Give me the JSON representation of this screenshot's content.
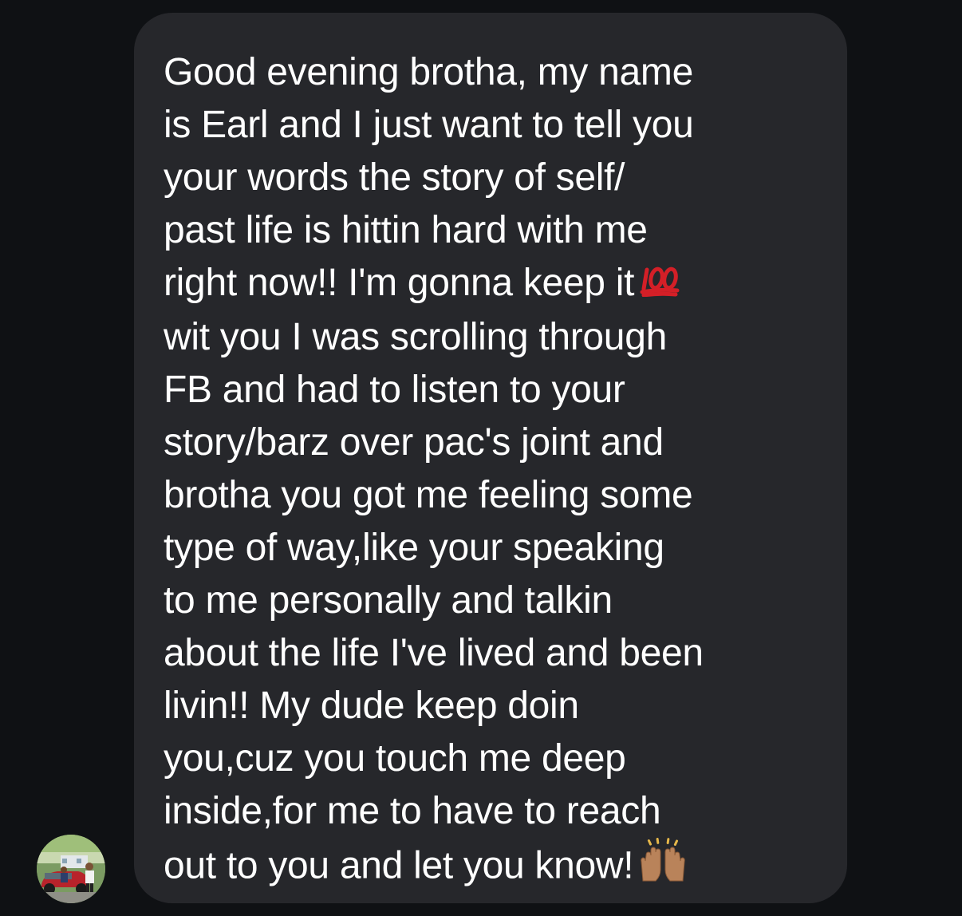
{
  "message": {
    "lines": [
      "Good evening brotha, my name",
      "is Earl and I just want to tell you",
      "your words the story of self/",
      "past life is hittin hard with me",
      "right now!! I'm gonna keep it",
      "wit you I was scrolling through",
      "FB and had to listen to your",
      "story/barz over pac's joint and",
      "brotha you got me feeling some",
      "type of way,like your speaking",
      "to me personally and talkin",
      "about the life I've lived and been",
      "livin!! My dude keep doin",
      "you,cuz you touch me deep",
      "inside,for me to have to reach",
      "out to you and let you know!"
    ],
    "emojis": {
      "hundred_points": "hundred-points-emoji",
      "raising_hands": "raising-hands-emoji"
    },
    "colors": {
      "background": "#0f1114",
      "bubble": "#26272b",
      "text": "#ffffff",
      "hundred_red": "#d41f27",
      "hands_skin": "#b9835a"
    }
  },
  "sender": {
    "avatar": "user-avatar-photo"
  }
}
